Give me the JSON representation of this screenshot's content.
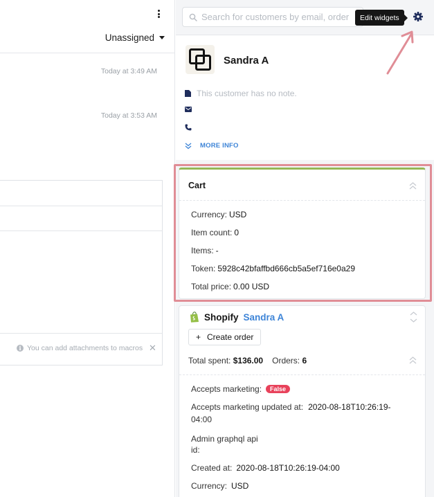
{
  "left_pane": {
    "assignee": "Unassigned",
    "messages": [
      {
        "timestamp": "Today at 3:49 AM"
      },
      {
        "timestamp": "Today at 3:53 AM"
      }
    ],
    "attachment_notice": "You can add attachments to macros"
  },
  "sidebar": {
    "search_placeholder": "Search for customers by email, order",
    "tooltip": "Edit widgets",
    "customer": {
      "name": "Sandra A",
      "note_placeholder": "This customer has no note.",
      "more_info": "MORE INFO"
    },
    "cart": {
      "title": "Cart",
      "fields": [
        {
          "label": "Currency:",
          "value": "USD"
        },
        {
          "label": "Item count:",
          "value": "0"
        },
        {
          "label": "Items:",
          "value": "-"
        },
        {
          "label": "Token:",
          "value": "5928c42bfaffbd666cb5a5ef716e0a29"
        },
        {
          "label": "Total price:",
          "value": "0.00 USD"
        }
      ]
    },
    "shopify": {
      "brand": "Shopify",
      "customer_name": "Sandra A",
      "create_order_label": "Create order",
      "total_spent_label": "Total spent:",
      "total_spent_value": "$136.00",
      "orders_label": "Orders:",
      "orders_value": "6",
      "accepts_marketing_label": "Accepts marketing:",
      "accepts_marketing_value": "False",
      "accepts_marketing_updated_label": "Accepts marketing updated at:",
      "accepts_marketing_updated_value": "2020-08-18T10:26:19-",
      "accepts_marketing_updated_value_2": "04:00",
      "admin_graphql_label": "Admin graphql api",
      "admin_graphql_label_2": "id:",
      "created_at_label": "Created at:",
      "created_at_value": "2020-08-18T10:26:19-04:00",
      "currency_label": "Currency:",
      "currency_value": "USD"
    }
  },
  "colors": {
    "accent_blue": "#3d84d7",
    "highlight_pink": "#e08d96",
    "cart_top_green": "#94b756",
    "false_badge_red": "#e8425b",
    "icon_navy": "#1f2d5c"
  }
}
